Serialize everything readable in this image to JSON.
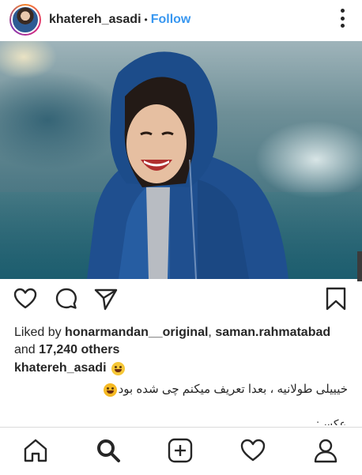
{
  "header": {
    "username": "khatereh_asadi",
    "separator": "•",
    "follow_label": "Follow"
  },
  "post": {
    "liked_by_prefix": "Liked by ",
    "liked_by_user1": "honarmandan__original",
    "liked_by_sep": ", ",
    "liked_by_user2": "saman.rahmatabad",
    "and_text": "and ",
    "others_count": "17,240 others",
    "caption_username": "khatereh_asadi",
    "caption_text": "خیییلی طولانیه ، بعدا تعریف میکنم چی شده بود",
    "caption_more": "عکس:"
  },
  "icons": {
    "like": "heart-outline-icon",
    "comment": "comment-bubble-icon",
    "share": "paper-plane-icon",
    "save": "bookmark-icon",
    "home": "home-icon",
    "search": "search-icon",
    "add": "add-post-icon",
    "activity": "heart-icon",
    "profile": "profile-icon"
  },
  "colors": {
    "link_blue": "#3897f0",
    "text": "#262626",
    "divider": "#dbdbdb"
  }
}
